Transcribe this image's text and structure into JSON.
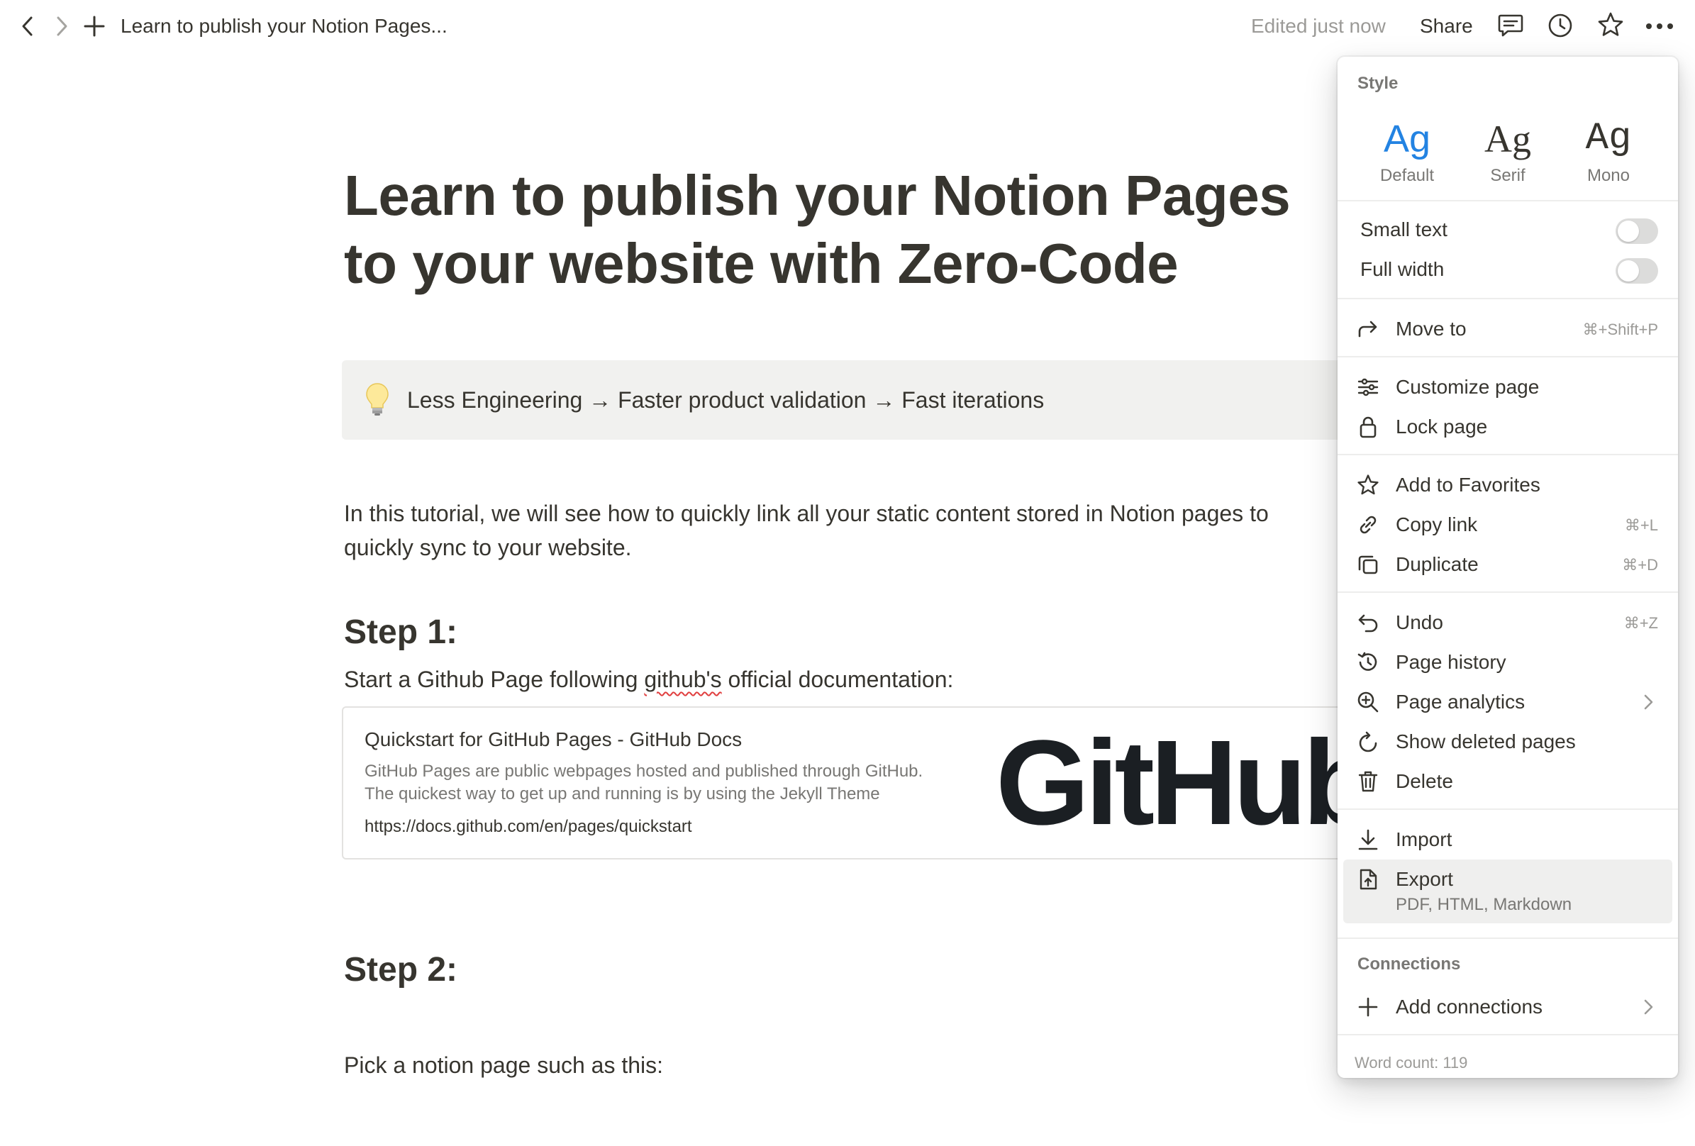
{
  "topbar": {
    "breadcrumb": "Learn to publish your Notion Pages...",
    "edited": "Edited just now",
    "share": "Share"
  },
  "page": {
    "title": "Learn to publish your Notion Pages to your website with Zero-Code",
    "callout_emoji": "light-bulb-icon",
    "callout_text": "Less Engineering → Faster product validation → Fast iterations",
    "intro_line1": "In this tutorial, we will see how to quickly link all your static content stored in Notion pages to",
    "intro_line2": "quickly sync to your website.",
    "step1_heading": "Step 1:",
    "step1_text_before": "Start a Github Page following ",
    "step1_text_link": "github's",
    "step1_text_after": " official documentation:",
    "bookmark": {
      "title": "Quickstart for GitHub Pages - GitHub Docs",
      "desc_line1": "GitHub Pages are public webpages hosted and published through GitHub.",
      "desc_line2": "The quickest way to get up and running is by using the Jekyll Theme",
      "url": "https://docs.github.com/en/pages/quickstart",
      "image_text": "GitHub"
    },
    "step2_heading": "Step 2:",
    "step2_text": "Pick a notion page such as this:"
  },
  "menu": {
    "style_label": "Style",
    "styles": [
      {
        "glyph": "Ag",
        "name": "Default",
        "active": true
      },
      {
        "glyph": "Ag",
        "name": "Serif",
        "active": false
      },
      {
        "glyph": "Ag",
        "name": "Mono",
        "active": false
      }
    ],
    "small_text": "Small text",
    "full_width": "Full width",
    "move_to": "Move to",
    "move_to_shortcut": "⌘+Shift+P",
    "customize_page": "Customize page",
    "lock_page": "Lock page",
    "add_to_favorites": "Add to Favorites",
    "copy_link": "Copy link",
    "copy_link_shortcut": "⌘+L",
    "duplicate": "Duplicate",
    "duplicate_shortcut": "⌘+D",
    "undo": "Undo",
    "undo_shortcut": "⌘+Z",
    "page_history": "Page history",
    "page_analytics": "Page analytics",
    "show_deleted_pages": "Show deleted pages",
    "delete": "Delete",
    "import": "Import",
    "export": "Export",
    "export_sub": "PDF, HTML, Markdown",
    "connections_label": "Connections",
    "add_connections": "Add connections",
    "word_count": "Word count: 119"
  },
  "colors": {
    "accent": "#2383e2",
    "text": "#37352f",
    "muted": "#9b9a97",
    "callout_bg": "#f1f1ef",
    "menu_highlight": "#efefee"
  }
}
